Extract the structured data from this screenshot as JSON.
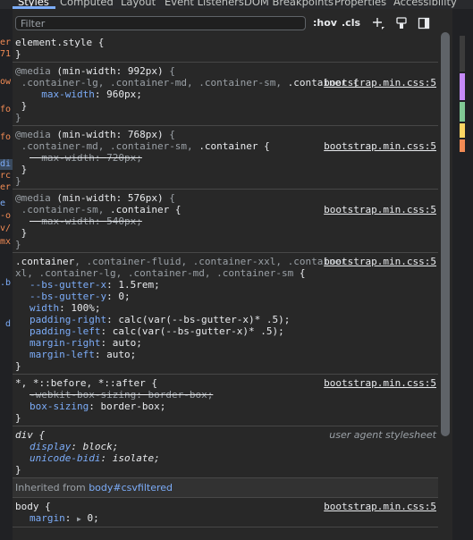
{
  "tabs": [
    "Styles",
    "Computed",
    "Layout",
    "Event Listeners",
    "DOM Breakpoints",
    "Properties",
    "Accessibility"
  ],
  "toolbar": {
    "filter_placeholder": "Filter",
    "hov_label": ":hov",
    "cls_label": ".cls",
    "icons": [
      "plus-icon",
      "paint-brush-icon",
      "sidebar-toggle-icon"
    ]
  },
  "gutter_fragments": [
    "er",
    "71",
    "ow",
    "fo",
    "fo",
    "di",
    "rc",
    "er",
    "e",
    "-o",
    "v/",
    "mx",
    ".b",
    "d"
  ],
  "rules": {
    "element_style": {
      "selector": "element.style {",
      "close": "}"
    },
    "media992": {
      "at": "@media",
      "query": "(min-width: 992px)",
      "open": " {",
      "selector_dim": ".container-lg, .container-md, .container-sm, ",
      "selector": ".container",
      "selector_end": " {",
      "source": "bootstrap.min.css:5",
      "prop": "max-width",
      "value": "960px;",
      "close_inner": "}",
      "close_outer": "}"
    },
    "media768": {
      "at": "@media",
      "query": "(min-width: 768px)",
      "open": " {",
      "selector_dim": ".container-md, .container-sm, ",
      "selector": ".container",
      "selector_end": " {",
      "source": "bootstrap.min.css:5",
      "prop": "max-width",
      "value": "720px;",
      "close_inner": "}",
      "close_outer": "}"
    },
    "media576": {
      "at": "@media",
      "query": "(min-width: 576px)",
      "open": " {",
      "selector_dim": ".container-sm, ",
      "selector": ".container",
      "selector_end": " {",
      "source": "bootstrap.min.css:5",
      "prop": "max-width",
      "value": "540px;",
      "close_inner": "}",
      "close_outer": "}"
    },
    "container": {
      "selector_main": ".container",
      "selector_rest1": ", .container-fluid, .container-xxl, .container-",
      "selector_rest2": "xl, .container-lg, .container-md, .container-sm",
      "selector_end": " {",
      "source": "bootstrap.min.css:5",
      "decls": [
        {
          "p": "--bs-gutter-x",
          "v": "1.5rem;"
        },
        {
          "p": "--bs-gutter-y",
          "v": "0;"
        },
        {
          "p": "width",
          "v": "100%;"
        },
        {
          "p": "padding-right",
          "v": "calc(var(--bs-gutter-x)* .5);"
        },
        {
          "p": "padding-left",
          "v": "calc(var(--bs-gutter-x)* .5);"
        },
        {
          "p": "margin-right",
          "v": "auto;"
        },
        {
          "p": "margin-left",
          "v": "auto;"
        }
      ],
      "close": "}"
    },
    "universal": {
      "selector": "*, *::before, *::after {",
      "source": "bootstrap.min.css:5",
      "d1p": "-webkit-box-sizing",
      "d1v": "border-box;",
      "d2p": "box-sizing",
      "d2v": "border-box;",
      "close": "}"
    },
    "div": {
      "selector": "div {",
      "source": "user agent stylesheet",
      "d1p": "display",
      "d1v": "block;",
      "d2p": "unicode-bidi",
      "d2v": "isolate;",
      "close": "}"
    },
    "inherited": {
      "label": "Inherited from ",
      "node": "body#csvfiltered"
    },
    "body": {
      "selector": "body {",
      "source": "bootstrap.min.css:5",
      "d1p": "margin",
      "d1v": "0;"
    }
  },
  "colors": {
    "background": "#282828",
    "property": "#7cacf8",
    "accent": "#7cacf8",
    "gutter_orange": "#f28b54",
    "gutter_blue": "#7cacf8"
  }
}
